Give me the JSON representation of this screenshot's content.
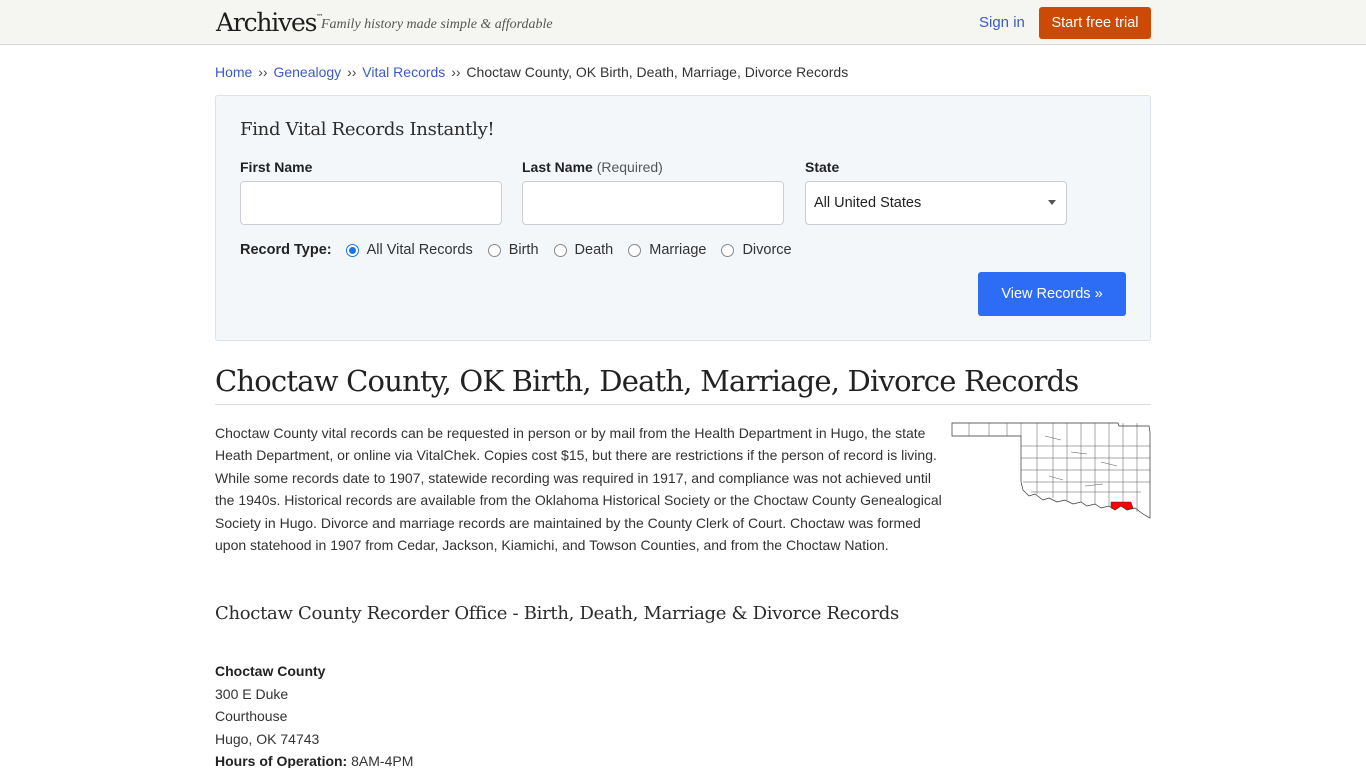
{
  "header": {
    "logo": "Archives",
    "logo_tm": "™",
    "tagline": "Family history made simple & affordable",
    "signin_label": "Sign in",
    "trial_label": "Start free trial"
  },
  "breadcrumb": {
    "items": [
      "Home",
      "Genealogy",
      "Vital Records"
    ],
    "separator": "››",
    "current": "Choctaw County, OK Birth, Death, Marriage, Divorce Records"
  },
  "search": {
    "title": "Find Vital Records Instantly!",
    "first_name_label": "First Name",
    "first_name_value": "",
    "last_name_label": "Last Name",
    "last_name_required": "(Required)",
    "last_name_value": "",
    "state_label": "State",
    "state_selected": "All United States",
    "record_type_label": "Record Type:",
    "record_types": [
      {
        "label": "All Vital Records",
        "checked": true
      },
      {
        "label": "Birth",
        "checked": false
      },
      {
        "label": "Death",
        "checked": false
      },
      {
        "label": "Marriage",
        "checked": false
      },
      {
        "label": "Divorce",
        "checked": false
      }
    ],
    "submit_label": "View Records »"
  },
  "main": {
    "title": "Choctaw County, OK Birth, Death, Marriage, Divorce Records",
    "intro": "Choctaw County vital records can be requested in person or by mail from the Health Department in Hugo, the state Heath Department, or online via VitalChek. Copies cost $15, but there are restrictions if the person of record is living. While some records date to 1907, statewide recording was required in 1917, and compliance was not achieved until the 1940s. Historical records are available from the Oklahoma Historical Society or the Choctaw County Genealogical Society in Hugo. Divorce and marriage records are maintained by the County Clerk of Court. Choctaw was formed upon statehood in 1907 from Cedar, Jackson, Kiamichi, and Towson Counties, and from the Choctaw Nation.",
    "map": {
      "state": "Oklahoma",
      "highlighted_county": "Choctaw County",
      "highlight_color": "#ff0000"
    },
    "office_heading": "Choctaw County Recorder Office - Birth, Death, Marriage & Divorce Records",
    "office": {
      "name": "Choctaw County",
      "address_lines": [
        "300 E Duke",
        "Courthouse",
        "Hugo, OK 74743"
      ],
      "hours_label": "Hours of Operation:",
      "hours_value": "8AM-4PM"
    }
  },
  "colors": {
    "link": "#3c5ac8",
    "trial_button": "#cc4a05",
    "view_button": "#2d6df6",
    "search_bg": "#f4f7fa"
  }
}
